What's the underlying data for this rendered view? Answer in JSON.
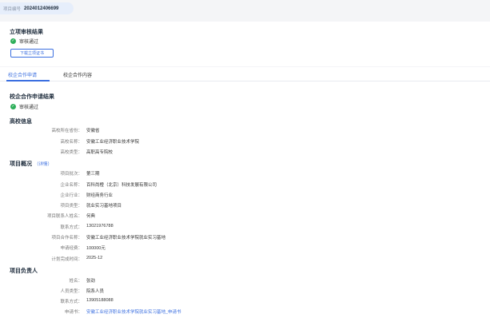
{
  "header": {
    "project_no_label": "项目编号",
    "project_no": "2024012406699"
  },
  "approval": {
    "title": "立项审核结果",
    "status": "审核通过",
    "download_button": "下载立项证书"
  },
  "tabs": [
    {
      "label": "校企合作申请"
    },
    {
      "label": "校企合作内容"
    }
  ],
  "application": {
    "title": "校企合作申请结果",
    "status": "审核通过"
  },
  "school": {
    "title": "高校信息",
    "fields": [
      {
        "label": "高校所在省份：",
        "value": "安徽省"
      },
      {
        "label": "高校名称：",
        "value": "安徽工业经济职业技术学院"
      },
      {
        "label": "高校类型：",
        "value": "高职高专院校"
      }
    ]
  },
  "overview": {
    "title": "项目概况",
    "detail_link": "（详情）",
    "fields": [
      {
        "label": "项目批次：",
        "value": "第三期"
      },
      {
        "label": "企业名称：",
        "value": "百科尚橙（北京）科技发展有限公司"
      },
      {
        "label": "企业行业：",
        "value": "财经商务行业"
      },
      {
        "label": "项目类型：",
        "value": "就业实习基地项目"
      },
      {
        "label": "项目联系人姓名：",
        "value": "何典"
      },
      {
        "label": "联系方式：",
        "value": "13021976788"
      },
      {
        "label": "项目合作名称：",
        "value": "安徽工业经济职业技术学院就业实习基地"
      },
      {
        "label": "申请经费：",
        "value": "100000元"
      },
      {
        "label": "计划完成时间：",
        "value": "2025-12"
      }
    ]
  },
  "owner": {
    "title": "项目负责人",
    "fields": [
      {
        "label": "姓名：",
        "value": "张劲"
      },
      {
        "label": "人员类型：",
        "value": "院系人员"
      },
      {
        "label": "联系方式：",
        "value": "13905188088"
      },
      {
        "label": "申请书：",
        "value": "安徽工业经济职业技术学院就业实习基地_申请书"
      }
    ]
  },
  "colors": {
    "accent": "#3b6fe0",
    "success": "#2eaf5a",
    "background": "#f4f5f7"
  },
  "icons": {
    "status": "check-circle-icon"
  }
}
